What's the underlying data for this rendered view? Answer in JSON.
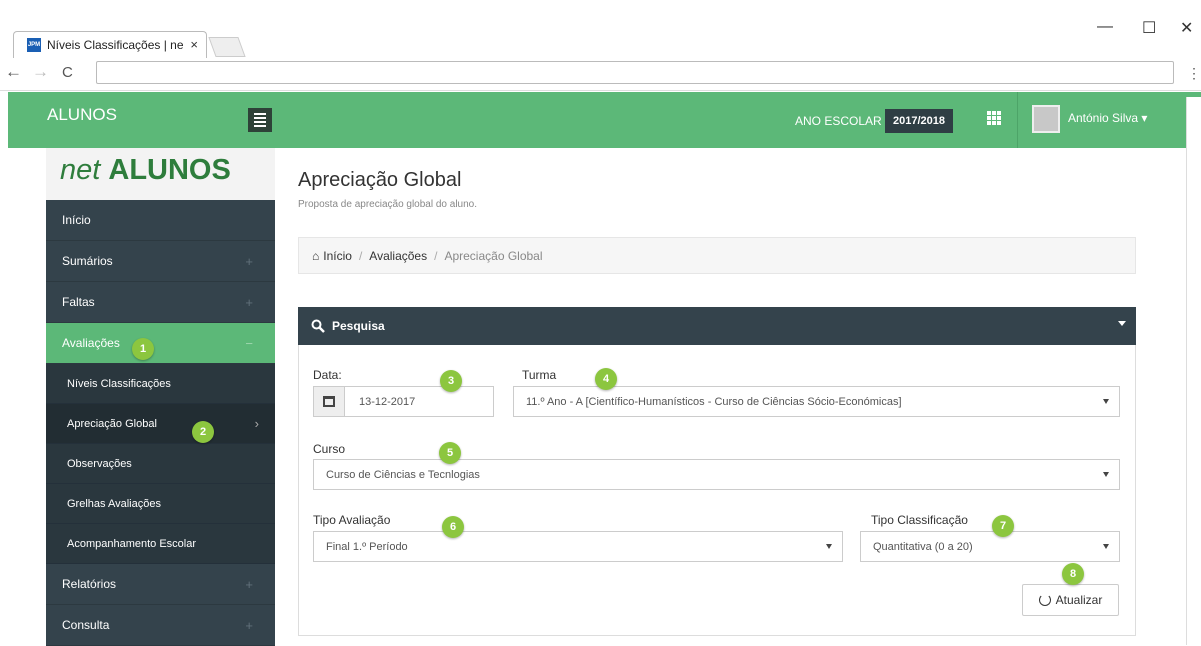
{
  "browser": {
    "tab_title": "Níveis Classificações | ne",
    "tab_favicon": "JPM",
    "tab_close": "×",
    "minimize": "—",
    "maximize": "☐",
    "close": "✕",
    "back": "←",
    "forward": "→",
    "reload": "C",
    "address": "",
    "menu": "⋮"
  },
  "header": {
    "app_title": "ALUNOS",
    "ano_label": "ANO ESCOLAR",
    "ano_value": "2017/2018",
    "user_name": "António Silva ▾"
  },
  "sidebar": {
    "brand_net": "net",
    "brand_alunos": "ALUNOS",
    "items": [
      {
        "label": "Início",
        "plus": ""
      },
      {
        "label": "Sumários",
        "plus": "+"
      },
      {
        "label": "Faltas",
        "plus": "+"
      },
      {
        "label": "Avaliações",
        "plus": "−"
      }
    ],
    "sub_items": [
      {
        "label": "Níveis Classificações"
      },
      {
        "label": "Apreciação Global",
        "chevron": "›"
      },
      {
        "label": "Observações"
      },
      {
        "label": "Grelhas Avaliações"
      },
      {
        "label": "Acompanhamento Escolar"
      }
    ],
    "bottom_items": [
      {
        "label": "Relatórios",
        "plus": "+"
      },
      {
        "label": "Consulta",
        "plus": "+"
      }
    ]
  },
  "main": {
    "title": "Apreciação Global",
    "subtitle": "Proposta de apreciação global do aluno.",
    "breadcrumb": {
      "home_icon": "⌂",
      "home": "Início",
      "sep": "/",
      "level1": "Avaliações",
      "current": "Apreciação Global"
    },
    "panel": {
      "title": "Pesquisa",
      "data_label": "Data:",
      "data_value": "13-12-2017",
      "turma_label": "Turma",
      "turma_value": "11.º Ano - A [Científico-Humanísticos - Curso de Ciências Sócio-Económicas]",
      "curso_label": "Curso",
      "curso_value": "Curso de Ciências e Tecnlogias",
      "tipo_aval_label": "Tipo Avaliação",
      "tipo_aval_value": "Final 1.º Período",
      "tipo_class_label": "Tipo Classificação",
      "tipo_class_value": "Quantitativa (0 a 20)",
      "button": "Atualizar"
    }
  },
  "badges": [
    "1",
    "2",
    "3",
    "4",
    "5",
    "6",
    "7",
    "8"
  ],
  "colors": {
    "accent": "#5cb878",
    "dark": "#34434c",
    "badge": "#8cc63f"
  }
}
